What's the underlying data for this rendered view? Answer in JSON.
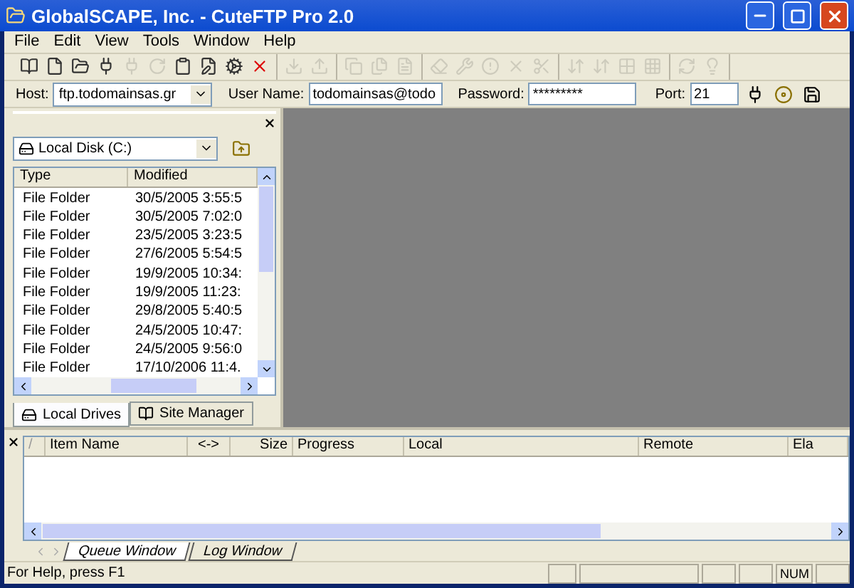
{
  "window": {
    "title": "GlobalSCAPE, Inc. - CuteFTP Pro 2.0"
  },
  "menu": [
    "File",
    "Edit",
    "View",
    "Tools",
    "Window",
    "Help"
  ],
  "toolbar": [
    [
      {
        "disabled": false
      },
      {
        "disabled": false
      },
      {
        "disabled": false
      },
      {
        "disabled": false
      },
      {
        "disabled": true
      },
      {
        "disabled": true
      },
      {
        "disabled": false
      },
      {
        "disabled": false
      },
      {
        "disabled": false
      },
      {
        "disabled": false
      }
    ],
    [
      {
        "disabled": true
      },
      {
        "disabled": true
      }
    ],
    [
      {
        "disabled": true
      },
      {
        "disabled": true
      },
      {
        "disabled": true
      }
    ],
    [
      {
        "disabled": true
      },
      {
        "disabled": true
      },
      {
        "disabled": true
      },
      {
        "disabled": true
      },
      {
        "disabled": true
      }
    ],
    [
      {
        "disabled": true
      },
      {
        "disabled": true
      },
      {
        "disabled": true
      },
      {
        "disabled": true
      }
    ],
    [
      {
        "disabled": true
      },
      {
        "disabled": true
      }
    ]
  ],
  "connect": {
    "host_label": "Host:",
    "host": "ftp.todomainsas.gr",
    "user_label": "User Name:",
    "user": "todomainsas@todo",
    "password_label": "Password:",
    "password": "*********",
    "port_label": "Port:",
    "port": "21"
  },
  "local_panel": {
    "drive": "Local Disk (C:)",
    "columns": [
      "Type",
      "Modified"
    ],
    "rows": [
      [
        "File Folder",
        "30/5/2005 3:55:5"
      ],
      [
        "File Folder",
        "30/5/2005 7:02:0"
      ],
      [
        "File Folder",
        "23/5/2005 3:23:5"
      ],
      [
        "File Folder",
        "27/6/2005 5:54:5"
      ],
      [
        "File Folder",
        "19/9/2005 10:34:"
      ],
      [
        "File Folder",
        "19/9/2005 11:23:"
      ],
      [
        "File Folder",
        "29/8/2005 5:40:5"
      ],
      [
        "File Folder",
        "24/5/2005 10:47:"
      ],
      [
        "File Folder",
        "24/5/2005 9:56:0"
      ],
      [
        "File Folder",
        "17/10/2006 11:4."
      ]
    ],
    "tabs": [
      {
        "label": "Local Drives",
        "selected": true
      },
      {
        "label": "Site Manager",
        "selected": false
      }
    ]
  },
  "queue": {
    "columns": [
      "/",
      "Item Name",
      "<->",
      "Size",
      "Progress",
      "Local",
      "Remote",
      "Ela"
    ],
    "tabs": [
      {
        "label": "Queue Window",
        "selected": true
      },
      {
        "label": "Log Window",
        "selected": false
      }
    ]
  },
  "status_bar": {
    "text": "For Help, press F1",
    "num": "NUM"
  }
}
